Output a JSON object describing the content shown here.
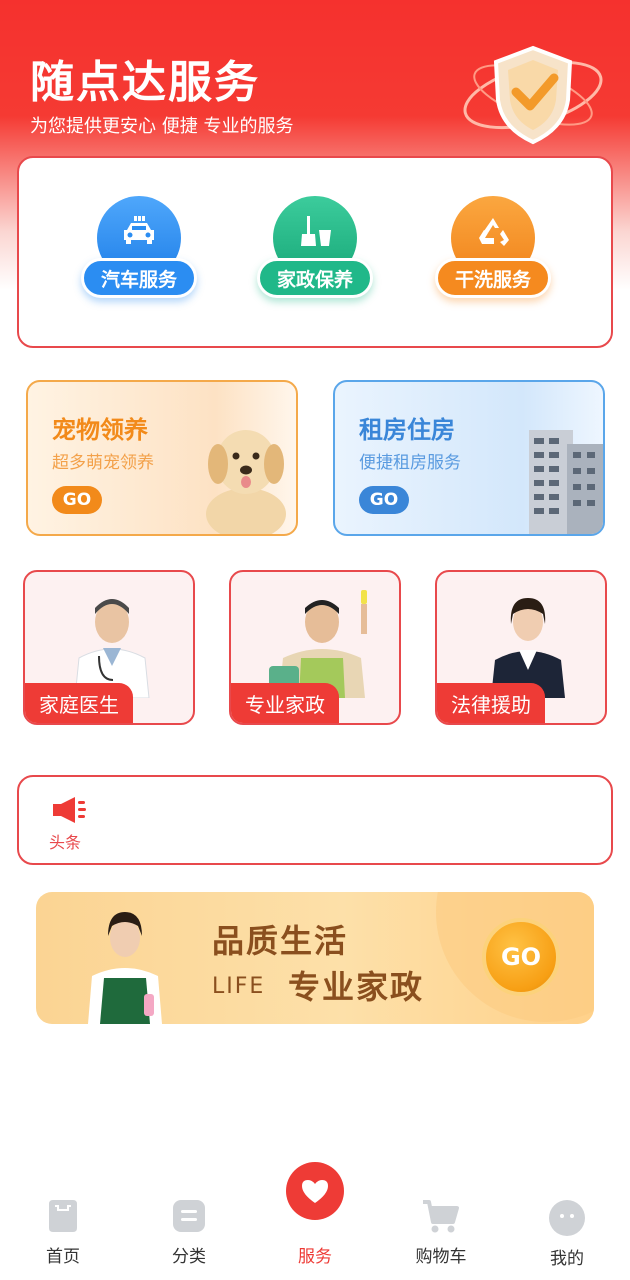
{
  "header": {
    "title": "随点达服务",
    "subtitle": "为您提供更安心 便捷 专业的服务"
  },
  "services": [
    {
      "label": "汽车服务",
      "icon": "car-icon",
      "color": "#2b8df2"
    },
    {
      "label": "家政保养",
      "icon": "cleaning-icon",
      "color": "#20b889"
    },
    {
      "label": "干洗服务",
      "icon": "recycle-icon",
      "color": "#f58a1f"
    }
  ],
  "promos": {
    "pet": {
      "title": "宠物领养",
      "subtitle": "超多萌宠领养",
      "go": "GO"
    },
    "house": {
      "title": "租房住房",
      "subtitle": "便捷租房服务",
      "go": "GO"
    }
  },
  "professionals": [
    {
      "label": "家庭医生"
    },
    {
      "label": "专业家政"
    },
    {
      "label": "法律援助"
    }
  ],
  "news": {
    "label": "头条",
    "icon": "megaphone-icon"
  },
  "banner": {
    "title": "品质生活",
    "life": "LIFE",
    "tagline": "专业家政",
    "go": "GO"
  },
  "tabbar": {
    "items": [
      {
        "label": "首页",
        "icon": "home-icon"
      },
      {
        "label": "分类",
        "icon": "category-icon"
      },
      {
        "label": "服务",
        "icon": "heart-icon",
        "active": true
      },
      {
        "label": "购物车",
        "icon": "cart-icon"
      },
      {
        "label": "我的",
        "icon": "profile-icon"
      }
    ]
  },
  "colors": {
    "brand_red": "#f5312e",
    "active_tab": "#ee3b36",
    "pet_accent": "#f28a1a",
    "house_accent": "#3a86d8"
  }
}
